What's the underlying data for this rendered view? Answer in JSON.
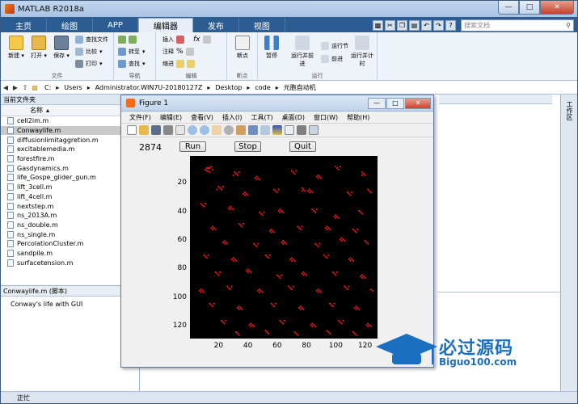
{
  "window": {
    "title": "MATLAB R2018a"
  },
  "tabs": [
    {
      "label": "主页"
    },
    {
      "label": "绘图"
    },
    {
      "label": "APP"
    },
    {
      "label": "编辑器"
    },
    {
      "label": "发布"
    },
    {
      "label": "视图"
    }
  ],
  "search": {
    "placeholder": "搜索文档"
  },
  "ribbon": {
    "file": {
      "label": "文件",
      "new": "新建",
      "open": "打开",
      "save": "保存",
      "find_files": "查找文件",
      "compare": "比较",
      "print": "打印"
    },
    "navigate": {
      "label": "导航",
      "goto": "转至",
      "find": "查找"
    },
    "edit": {
      "label": "编辑",
      "insert": "插入",
      "comment": "注释",
      "indent": "缩进",
      "fx": "fx"
    },
    "breakpoints": {
      "label": "断点",
      "breakpoints": "断点"
    },
    "run": {
      "label": "运行",
      "pause": "暂停",
      "run_advance": "运行并前进",
      "run_section": "运行节",
      "advance": "前进",
      "run_time": "运行并计时"
    }
  },
  "address": {
    "path": [
      "C:",
      "Users",
      "Administrator.WIN7U-20180127Z",
      "Desktop",
      "code",
      "元胞自动机"
    ]
  },
  "current_folder": {
    "title": "当前文件夹",
    "column": "名称",
    "files": [
      "cell2im.m",
      "Conwaylife.m",
      "diffusionlimitaggretion.m",
      "excitablemedia.m",
      "forestfire.m",
      "Gasdynamics.m",
      "life_Gospe_glider_gun.m",
      "lift_3cell.m",
      "lift_4cell.m",
      "nextstep.m",
      "ns_2013A.m",
      "ns_double.m",
      "ns_single.m",
      "PercolationCluster.m",
      "sandpile.m",
      "surfacetension.m"
    ],
    "selected": 1
  },
  "detail": {
    "title": "Conwaylife.m (脚本)",
    "description": "Conway's life with GUI"
  },
  "right_panel": {
    "label": "工作区"
  },
  "status": {
    "text": "正忙"
  },
  "figure": {
    "title": "Figure 1",
    "menu": [
      "文件(F)",
      "编辑(E)",
      "查看(V)",
      "插入(I)",
      "工具(T)",
      "桌面(D)",
      "窗口(W)",
      "帮助(H)"
    ],
    "generation": "2874",
    "run_label": "Run",
    "stop_label": "Stop",
    "quit_label": "Quit"
  },
  "watermark": {
    "cn": "必过源码",
    "en": "Biguo100.com"
  },
  "chart_data": {
    "type": "heatmap",
    "title": "",
    "xlabel": "",
    "ylabel": "",
    "xticks": [
      20,
      40,
      60,
      80,
      100,
      120
    ],
    "yticks": [
      20,
      40,
      60,
      80,
      100,
      120
    ],
    "xlim": [
      0.5,
      128.5
    ],
    "ylim": [
      0.5,
      128.5
    ],
    "y_reversed": true,
    "background_color": "#000000",
    "cell_color": "#ff1a1a",
    "live_cells": [
      [
        12,
        9
      ],
      [
        13,
        9
      ],
      [
        14,
        9
      ],
      [
        15,
        8
      ],
      [
        16,
        10
      ],
      [
        12,
        11
      ],
      [
        13,
        11
      ],
      [
        14,
        12
      ],
      [
        11,
        10
      ],
      [
        31,
        12
      ],
      [
        32,
        13
      ],
      [
        33,
        14
      ],
      [
        34,
        12
      ],
      [
        30,
        14
      ],
      [
        46,
        15
      ],
      [
        47,
        16
      ],
      [
        48,
        17
      ],
      [
        46,
        17
      ],
      [
        45,
        16
      ],
      [
        70,
        11
      ],
      [
        71,
        12
      ],
      [
        72,
        13
      ],
      [
        73,
        11
      ],
      [
        88,
        14
      ],
      [
        89,
        15
      ],
      [
        90,
        16
      ],
      [
        88,
        16
      ],
      [
        87,
        15
      ],
      [
        100,
        8
      ],
      [
        101,
        9
      ],
      [
        102,
        10
      ],
      [
        103,
        8
      ],
      [
        118,
        12
      ],
      [
        119,
        13
      ],
      [
        120,
        14
      ],
      [
        118,
        14
      ],
      [
        20,
        22
      ],
      [
        21,
        23
      ],
      [
        22,
        24
      ],
      [
        23,
        22
      ],
      [
        19,
        24
      ],
      [
        38,
        26
      ],
      [
        39,
        27
      ],
      [
        40,
        28
      ],
      [
        38,
        28
      ],
      [
        37,
        27
      ],
      [
        58,
        24
      ],
      [
        59,
        25
      ],
      [
        60,
        26
      ],
      [
        61,
        24
      ],
      [
        77,
        23
      ],
      [
        78,
        24
      ],
      [
        79,
        25
      ],
      [
        77,
        25
      ],
      [
        82,
        24
      ],
      [
        83,
        25
      ],
      [
        84,
        26
      ],
      [
        82,
        26
      ],
      [
        81,
        25
      ],
      [
        108,
        26
      ],
      [
        109,
        27
      ],
      [
        110,
        28
      ],
      [
        111,
        26
      ],
      [
        122,
        24
      ],
      [
        123,
        25
      ],
      [
        124,
        26
      ],
      [
        8,
        34
      ],
      [
        9,
        35
      ],
      [
        10,
        36
      ],
      [
        11,
        34
      ],
      [
        28,
        36
      ],
      [
        29,
        37
      ],
      [
        30,
        38
      ],
      [
        28,
        38
      ],
      [
        27,
        37
      ],
      [
        48,
        40
      ],
      [
        49,
        41
      ],
      [
        50,
        42
      ],
      [
        51,
        40
      ],
      [
        62,
        38
      ],
      [
        63,
        39
      ],
      [
        64,
        40
      ],
      [
        62,
        40
      ],
      [
        61,
        39
      ],
      [
        84,
        38
      ],
      [
        85,
        39
      ],
      [
        86,
        40
      ],
      [
        87,
        38
      ],
      [
        100,
        42
      ],
      [
        101,
        43
      ],
      [
        102,
        44
      ],
      [
        100,
        44
      ],
      [
        99,
        43
      ],
      [
        116,
        39
      ],
      [
        117,
        40
      ],
      [
        118,
        41
      ],
      [
        16,
        50
      ],
      [
        17,
        51
      ],
      [
        18,
        52
      ],
      [
        16,
        52
      ],
      [
        15,
        51
      ],
      [
        34,
        48
      ],
      [
        35,
        49
      ],
      [
        36,
        50
      ],
      [
        37,
        48
      ],
      [
        56,
        52
      ],
      [
        57,
        53
      ],
      [
        58,
        54
      ],
      [
        56,
        54
      ],
      [
        55,
        53
      ],
      [
        74,
        50
      ],
      [
        75,
        51
      ],
      [
        76,
        52
      ],
      [
        77,
        50
      ],
      [
        94,
        50
      ],
      [
        95,
        51
      ],
      [
        96,
        52
      ],
      [
        94,
        52
      ],
      [
        93,
        51
      ],
      [
        112,
        52
      ],
      [
        113,
        53
      ],
      [
        114,
        54
      ],
      [
        115,
        52
      ],
      [
        24,
        60
      ],
      [
        25,
        61
      ],
      [
        26,
        62
      ],
      [
        24,
        62
      ],
      [
        23,
        61
      ],
      [
        44,
        62
      ],
      [
        45,
        63
      ],
      [
        46,
        64
      ],
      [
        47,
        62
      ],
      [
        64,
        60
      ],
      [
        65,
        61
      ],
      [
        66,
        62
      ],
      [
        64,
        62
      ],
      [
        63,
        61
      ],
      [
        86,
        62
      ],
      [
        87,
        63
      ],
      [
        88,
        64
      ],
      [
        89,
        62
      ],
      [
        104,
        58
      ],
      [
        105,
        59
      ],
      [
        106,
        60
      ],
      [
        104,
        60
      ],
      [
        103,
        59
      ],
      [
        120,
        60
      ],
      [
        121,
        61
      ],
      [
        122,
        62
      ],
      [
        10,
        70
      ],
      [
        11,
        71
      ],
      [
        12,
        72
      ],
      [
        13,
        70
      ],
      [
        30,
        72
      ],
      [
        31,
        73
      ],
      [
        32,
        74
      ],
      [
        30,
        74
      ],
      [
        29,
        73
      ],
      [
        52,
        70
      ],
      [
        53,
        71
      ],
      [
        54,
        72
      ],
      [
        55,
        70
      ],
      [
        70,
        72
      ],
      [
        71,
        73
      ],
      [
        72,
        74
      ],
      [
        70,
        74
      ],
      [
        69,
        73
      ],
      [
        92,
        70
      ],
      [
        93,
        71
      ],
      [
        94,
        72
      ],
      [
        95,
        70
      ],
      [
        110,
        72
      ],
      [
        111,
        73
      ],
      [
        112,
        74
      ],
      [
        110,
        74
      ],
      [
        109,
        73
      ],
      [
        18,
        82
      ],
      [
        19,
        83
      ],
      [
        20,
        84
      ],
      [
        21,
        82
      ],
      [
        40,
        80
      ],
      [
        41,
        81
      ],
      [
        42,
        82
      ],
      [
        40,
        82
      ],
      [
        39,
        81
      ],
      [
        60,
        84
      ],
      [
        61,
        85
      ],
      [
        62,
        86
      ],
      [
        63,
        84
      ],
      [
        78,
        82
      ],
      [
        79,
        83
      ],
      [
        80,
        84
      ],
      [
        78,
        84
      ],
      [
        77,
        83
      ],
      [
        98,
        82
      ],
      [
        99,
        83
      ],
      [
        100,
        84
      ],
      [
        101,
        82
      ],
      [
        118,
        84
      ],
      [
        119,
        85
      ],
      [
        120,
        86
      ],
      [
        118,
        86
      ],
      [
        117,
        85
      ],
      [
        8,
        94
      ],
      [
        9,
        95
      ],
      [
        10,
        96
      ],
      [
        8,
        96
      ],
      [
        7,
        95
      ],
      [
        26,
        92
      ],
      [
        27,
        93
      ],
      [
        28,
        94
      ],
      [
        29,
        92
      ],
      [
        48,
        94
      ],
      [
        49,
        95
      ],
      [
        50,
        96
      ],
      [
        48,
        96
      ],
      [
        47,
        95
      ],
      [
        68,
        92
      ],
      [
        69,
        93
      ],
      [
        70,
        94
      ],
      [
        71,
        92
      ],
      [
        88,
        94
      ],
      [
        89,
        95
      ],
      [
        90,
        96
      ],
      [
        88,
        96
      ],
      [
        87,
        95
      ],
      [
        106,
        92
      ],
      [
        107,
        93
      ],
      [
        108,
        94
      ],
      [
        109,
        92
      ],
      [
        124,
        94
      ],
      [
        125,
        95
      ],
      [
        14,
        104
      ],
      [
        15,
        105
      ],
      [
        16,
        106
      ],
      [
        17,
        104
      ],
      [
        34,
        106
      ],
      [
        35,
        107
      ],
      [
        36,
        108
      ],
      [
        34,
        108
      ],
      [
        33,
        107
      ],
      [
        56,
        104
      ],
      [
        57,
        105
      ],
      [
        58,
        106
      ],
      [
        59,
        104
      ],
      [
        76,
        106
      ],
      [
        77,
        107
      ],
      [
        78,
        108
      ],
      [
        76,
        108
      ],
      [
        75,
        107
      ],
      [
        96,
        104
      ],
      [
        97,
        105
      ],
      [
        98,
        106
      ],
      [
        99,
        104
      ],
      [
        114,
        106
      ],
      [
        115,
        107
      ],
      [
        116,
        108
      ],
      [
        114,
        108
      ],
      [
        113,
        107
      ],
      [
        22,
        116
      ],
      [
        23,
        117
      ],
      [
        24,
        118
      ],
      [
        25,
        116
      ],
      [
        42,
        118
      ],
      [
        43,
        119
      ],
      [
        44,
        120
      ],
      [
        42,
        120
      ],
      [
        41,
        119
      ],
      [
        62,
        116
      ],
      [
        63,
        117
      ],
      [
        64,
        118
      ],
      [
        65,
        116
      ],
      [
        84,
        118
      ],
      [
        85,
        119
      ],
      [
        86,
        120
      ],
      [
        84,
        120
      ],
      [
        83,
        119
      ],
      [
        102,
        116
      ],
      [
        103,
        117
      ],
      [
        104,
        118
      ],
      [
        105,
        116
      ],
      [
        122,
        118
      ],
      [
        123,
        119
      ],
      [
        124,
        120
      ],
      [
        122,
        120
      ],
      [
        121,
        119
      ],
      [
        32,
        124
      ],
      [
        33,
        125
      ],
      [
        34,
        126
      ],
      [
        52,
        123
      ],
      [
        53,
        124
      ],
      [
        54,
        125
      ],
      [
        72,
        124
      ],
      [
        73,
        125
      ],
      [
        74,
        126
      ],
      [
        94,
        123
      ],
      [
        95,
        124
      ],
      [
        96,
        125
      ],
      [
        112,
        124
      ],
      [
        113,
        125
      ],
      [
        114,
        126
      ]
    ]
  }
}
